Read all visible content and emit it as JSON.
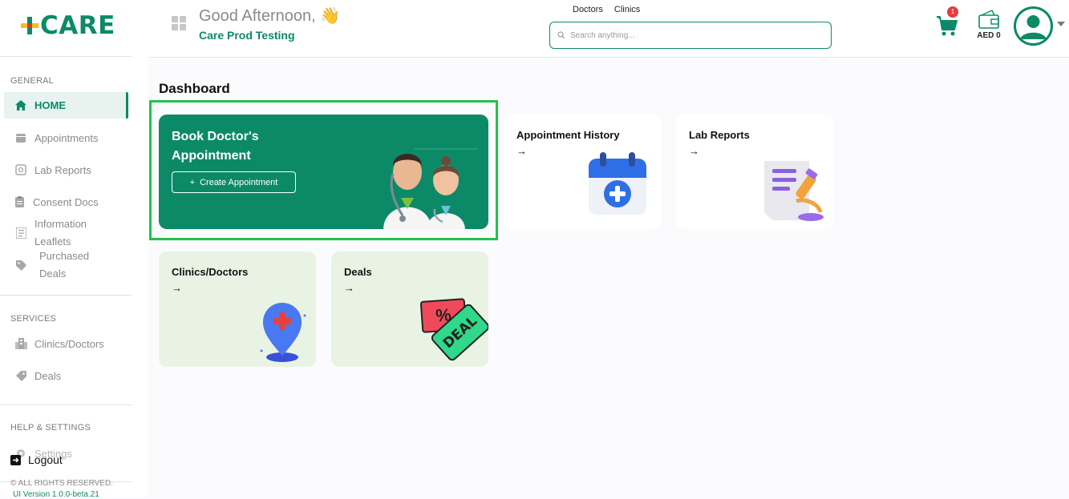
{
  "brand": {
    "logo_text": "CARE"
  },
  "sidebar": {
    "general_label": "GENERAL",
    "items": [
      {
        "label": "HOME"
      },
      {
        "label": "Appointments"
      },
      {
        "label": "Lab Reports"
      },
      {
        "label": "Consent Docs"
      },
      {
        "label_line1": "Information",
        "label_line2": "Leaflets"
      },
      {
        "label_line1": "Purchased",
        "label_line2": "Deals"
      }
    ],
    "services_label": "SERVICES",
    "services": [
      {
        "label": "Clinics/Doctors"
      },
      {
        "label": "Deals"
      }
    ],
    "help_label": "HELP & SETTINGS",
    "settings_label": "Settings",
    "logout_label": "Logout",
    "copyright": "© ALL RIGHTS RESERVED.",
    "version": "UI Version 1.0.0-beta.21"
  },
  "header": {
    "greeting": "Good Afternoon,",
    "greeting_emoji": "👋",
    "org_name": "Care Prod Testing",
    "search_tabs": [
      "Doctors",
      "Clinics"
    ],
    "search_placeholder": "Search anything...",
    "cart_count": "1",
    "wallet_amount": "AED 0"
  },
  "main": {
    "title": "Dashboard",
    "book_card": {
      "title": "Book Doctor's Appointment",
      "button_label": "Create Appointment",
      "button_icon": "+"
    },
    "cards": [
      {
        "title": "Appointment History",
        "arrow": "→"
      },
      {
        "title": "Lab Reports",
        "arrow": "→"
      },
      {
        "title": "Clinics/Doctors",
        "arrow": "→"
      },
      {
        "title": "Deals",
        "arrow": "→",
        "illustration_text": "DEAL",
        "illustration_symbol": "%"
      }
    ]
  },
  "colors": {
    "brand_green": "#0c8a68",
    "highlight_border": "#22c34a",
    "card_green_bg": "#e9f3e4",
    "badge_red": "#e53b3b"
  }
}
